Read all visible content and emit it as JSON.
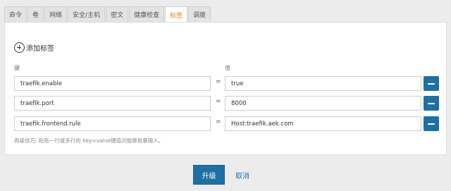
{
  "tabs": [
    {
      "label": "命令",
      "active": false
    },
    {
      "label": "卷",
      "active": false
    },
    {
      "label": "网络",
      "active": false
    },
    {
      "label": "安全/主机",
      "active": false
    },
    {
      "label": "密文",
      "active": false
    },
    {
      "label": "健康检查",
      "active": false
    },
    {
      "label": "标签",
      "active": true
    },
    {
      "label": "调度",
      "active": false
    }
  ],
  "add_tag_label": "添加标签",
  "columns": {
    "key_label": "键",
    "value_label": "值"
  },
  "equals_sign": "=",
  "rows": [
    {
      "key": "traefik.enable",
      "value": "true"
    },
    {
      "key": "traefik.port",
      "value": "8000"
    },
    {
      "key": "traefik.frontend.rule",
      "value": "Host:traefik.aek.com"
    }
  ],
  "hint": "高级技巧: 粘贴一行或多行的 key=value键值对能够批量输入。",
  "actions": {
    "upgrade_label": "升级",
    "cancel_label": "取消"
  },
  "colors": {
    "accent": "#1f6fa3",
    "active_tab": "#e67e22"
  }
}
